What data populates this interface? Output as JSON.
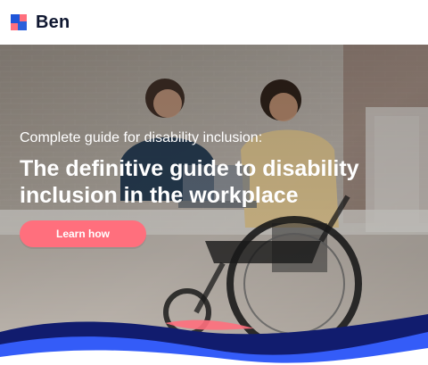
{
  "brand": {
    "name": "Ben"
  },
  "hero": {
    "eyebrow": "Complete guide for disability inclusion:",
    "headline": "The definitive guide to disability inclusion in the workplace",
    "cta_label": "Learn how"
  },
  "colors": {
    "brand_navy": "#0f1730",
    "brand_blue": "#1f56d9",
    "cta_coral": "#ff6f7d",
    "wave_navy": "#111c6e",
    "wave_blue": "#3760ff",
    "wave_white": "#ffffff"
  },
  "icons": {
    "brand_logo": "ben-logo-icon"
  }
}
